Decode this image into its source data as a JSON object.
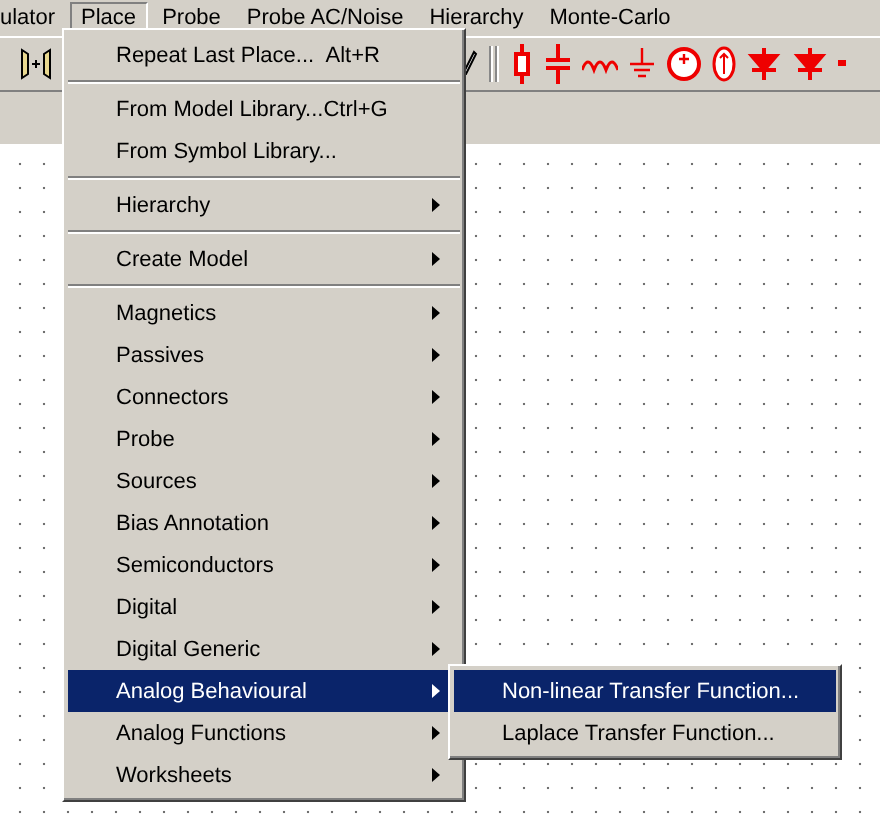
{
  "menubar": [
    {
      "label": "ulator",
      "selected": false
    },
    {
      "label": "Place",
      "selected": true
    },
    {
      "label": "Probe",
      "selected": false
    },
    {
      "label": "Probe AC/Noise",
      "selected": false
    },
    {
      "label": "Hierarchy",
      "selected": false
    },
    {
      "label": "Monte-Carlo",
      "selected": false
    }
  ],
  "menu": [
    {
      "label": "Repeat Last Place...",
      "shortcut": "Alt+R",
      "submenu": false,
      "separator_after": true,
      "selected": false
    },
    {
      "label": "From Model Library...",
      "shortcut": "Ctrl+G",
      "submenu": false,
      "separator_after": false,
      "selected": false
    },
    {
      "label": "From Symbol Library...",
      "submenu": false,
      "separator_after": true,
      "selected": false
    },
    {
      "label": "Hierarchy",
      "submenu": true,
      "separator_after": true,
      "selected": false
    },
    {
      "label": "Create Model",
      "submenu": true,
      "separator_after": true,
      "selected": false
    },
    {
      "label": "Magnetics",
      "submenu": true,
      "separator_after": false,
      "selected": false
    },
    {
      "label": "Passives",
      "submenu": true,
      "separator_after": false,
      "selected": false
    },
    {
      "label": "Connectors",
      "submenu": true,
      "separator_after": false,
      "selected": false
    },
    {
      "label": "Probe",
      "submenu": true,
      "separator_after": false,
      "selected": false
    },
    {
      "label": "Sources",
      "submenu": true,
      "separator_after": false,
      "selected": false
    },
    {
      "label": "Bias Annotation",
      "submenu": true,
      "separator_after": false,
      "selected": false
    },
    {
      "label": "Semiconductors",
      "submenu": true,
      "separator_after": false,
      "selected": false
    },
    {
      "label": "Digital",
      "submenu": true,
      "separator_after": false,
      "selected": false
    },
    {
      "label": "Digital Generic",
      "submenu": true,
      "separator_after": false,
      "selected": false
    },
    {
      "label": "Analog Behavioural",
      "submenu": true,
      "separator_after": false,
      "selected": true
    },
    {
      "label": "Analog Functions",
      "submenu": true,
      "separator_after": false,
      "selected": false
    },
    {
      "label": "Worksheets",
      "submenu": true,
      "separator_after": false,
      "selected": false
    }
  ],
  "submenu": [
    {
      "label": "Non-linear Transfer Function...",
      "selected": true
    },
    {
      "label": "Laplace Transfer Function...",
      "selected": false
    }
  ]
}
